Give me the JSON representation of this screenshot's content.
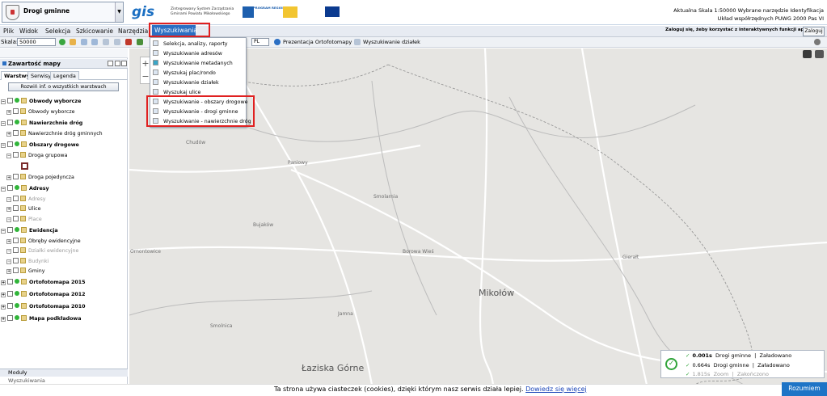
{
  "header": {
    "project_select": "Drogi gminne",
    "logo": "gis",
    "logo_text_1": "Zintegrowany System Zarządzania",
    "logo_text_2": "Gminami Powiatu Mikołowskiego",
    "program_text": "PROGRAM REGIONALNY",
    "info_line1": "Aktualna Skala 1:50000  Wybrane narzędzie Identyfikacja",
    "info_line2": "Układ współrzędnych PUWG 2000 Pas VI"
  },
  "menu": {
    "items": [
      "Plik",
      "Widok",
      "Selekcja",
      "Szkicowanie",
      "Narzędzia"
    ],
    "active": "Wyszukiwania",
    "login_info": "Zaloguj się, żeby korzystać z interaktywnych funkcji aplikacji",
    "login_button": "Zaloguj"
  },
  "toolbar": {
    "scale_label": "Skala:",
    "scale_value": "50000",
    "pl_value": "PL",
    "ortho_label": "Prezentacja Ortofotomapy",
    "parcel_label": "Wyszukiwanie działek"
  },
  "dropdown": {
    "items": [
      "Selekcja, analizy, raporty",
      "Wyszukiwanie adresów",
      "Wyszukiwanie metadanych",
      "Wyszukaj plac/rondo",
      "Wyszukiwanie działek",
      "Wyszukaj ulice",
      "Wyszukiwanie - obszary drogowe",
      "Wyszukiwanie - drogi gminne",
      "Wyszukiwanie - nawierzchnie dróg"
    ]
  },
  "left_panel": {
    "title": "Zawartość mapy",
    "tabs": [
      "Warstwy",
      "Serwisy",
      "Legenda"
    ],
    "expand_button": "Rozwiń inf. o wszystkich warstwach",
    "layers": [
      "Obwody wyborcze",
      "Obwody wyborcze",
      "Nawierzchnie dróg",
      "Nawierzchnie dróg gminnych",
      "Obszary drogowe",
      "Droga grupowa",
      "Droga pojedyncza",
      "Adresy",
      "Adresy",
      "Ulice",
      "Place",
      "Ewidencja",
      "Obręby ewidencyjne",
      "Działki ewidencyjne",
      "Budynki",
      "Gminy",
      "Ortofotomapa 2015",
      "Ortofotomapa 2012",
      "Ortofotomapa 2010",
      "Mapa podkładowa"
    ],
    "modules_label": "Moduły",
    "search_label": "Wyszukiwania"
  },
  "map": {
    "labels": [
      "Chudów",
      "Paniowy",
      "Smolarnia",
      "Bujaków",
      "Borowa Wieś",
      "Mikołów",
      "Łaziska Górne",
      "Ornontowice",
      "Jamna",
      "Gierałt",
      "Smolnica"
    ],
    "city_main": "Mikołów",
    "city_bottom": "Łaziska Górne"
  },
  "status": {
    "rows": [
      {
        "time": "0.001s",
        "layer": "Drogi gminne",
        "state": "Załadowano"
      },
      {
        "time": "0.664s",
        "layer": "Drogi gminne",
        "state": "Załadowano"
      },
      {
        "time": "1.815s",
        "layer": "Zoom",
        "state": "Zakończono"
      }
    ]
  },
  "cookie": {
    "text": "Ta strona używa ciasteczek (cookies), dzięki którym nasz serwis działa lepiej.",
    "link": "Dowiedz się więcej",
    "button": "Rozumiem"
  },
  "colors": {
    "accent": "#2b6fc3",
    "highlight": "#e02020",
    "ok": "#31a43a"
  }
}
